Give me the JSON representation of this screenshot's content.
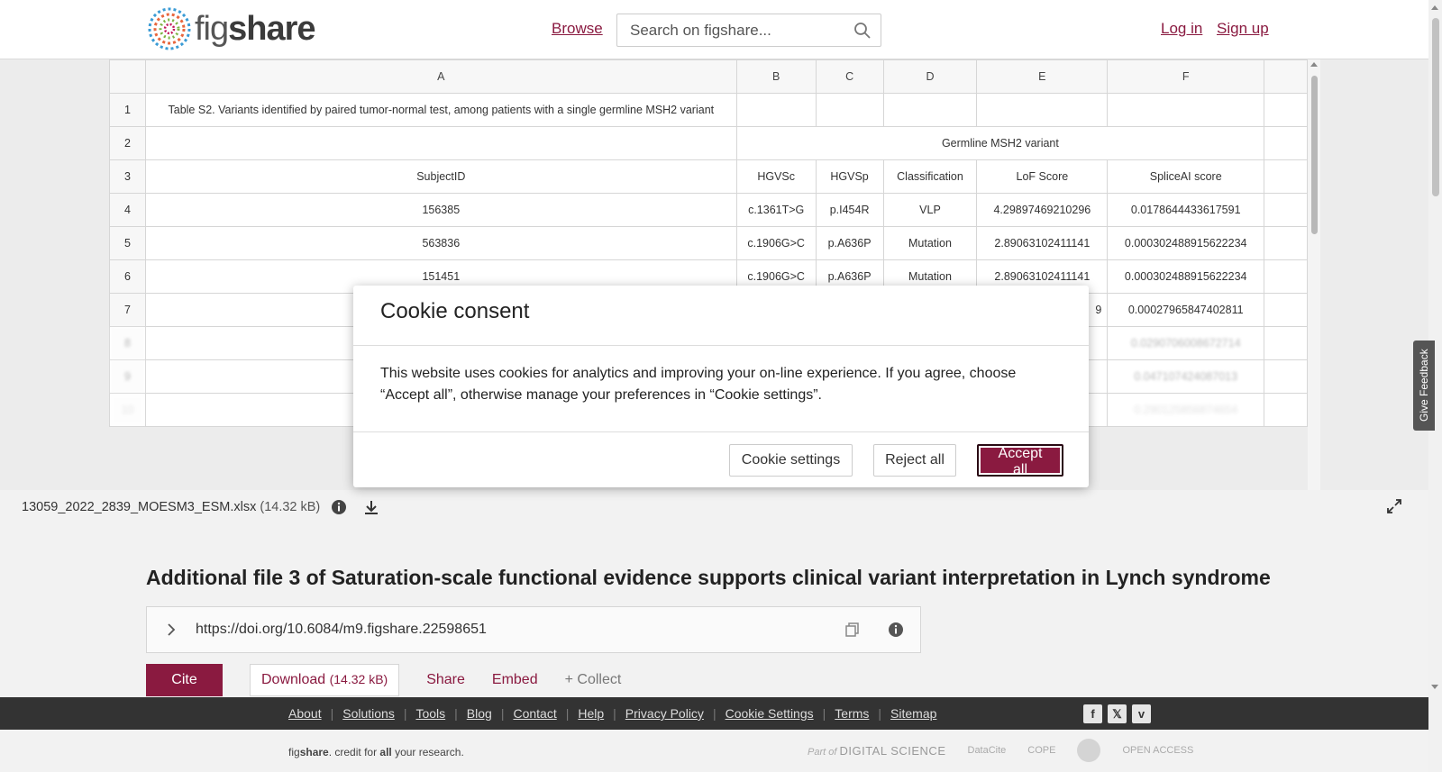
{
  "header": {
    "logo_fig": "fig",
    "logo_share": "share",
    "browse": "Browse",
    "search_placeholder": "Search on figshare...",
    "login": "Log in",
    "signup": "Sign up"
  },
  "sheet": {
    "columns": [
      "A",
      "B",
      "C",
      "D",
      "E",
      "F"
    ],
    "rows": [
      {
        "num": "1",
        "cells": [
          "Table S2. Variants identified by paired tumor-normal test, among patients with a single germline MSH2 variant",
          "",
          "",
          "",
          "",
          ""
        ]
      },
      {
        "num": "2",
        "cells": [
          "",
          "Germline MSH2 variant"
        ]
      },
      {
        "num": "3",
        "cells": [
          "SubjectID",
          "HGVSc",
          "HGVSp",
          "Classification",
          "LoF Score",
          "SpliceAI score"
        ]
      },
      {
        "num": "4",
        "cells": [
          "156385",
          "c.1361T>G",
          "p.I454R",
          "VLP",
          "4.29897469210296",
          "0.0178644433617591"
        ]
      },
      {
        "num": "5",
        "cells": [
          "563836",
          "c.1906G>C",
          "p.A636P",
          "Mutation",
          "2.89063102411141",
          "0.000302488915622234"
        ]
      },
      {
        "num": "6",
        "cells": [
          "151451",
          "c.1906G>C",
          "p.A636P",
          "Mutation",
          "2.89063102411141",
          "0.000302488915622234"
        ]
      },
      {
        "num": "7",
        "cells": [
          "",
          "",
          "",
          "",
          "9",
          "0.00027965847402811"
        ]
      },
      {
        "num": "8",
        "cells": [
          "",
          "",
          "",
          "",
          "",
          "0.0290706008672714"
        ]
      },
      {
        "num": "9",
        "cells": [
          "",
          "",
          "",
          "",
          "",
          "0.047107424087013"
        ]
      },
      {
        "num": "10",
        "cells": [
          "",
          "",
          "",
          "",
          "",
          "0.290125856874654"
        ]
      }
    ]
  },
  "file": {
    "name": "13059_2022_2839_MOESM3_ESM.xlsx",
    "size": "(14.32 kB)"
  },
  "article": {
    "title": "Additional file 3 of Saturation-scale functional evidence supports clinical variant interpretation in Lynch syndrome",
    "doi": "https://doi.org/10.6084/m9.figshare.22598651",
    "cite": "Cite",
    "download": "Download",
    "download_size": "(14.32 kB)",
    "share": "Share",
    "embed": "Embed",
    "collect": "+ Collect"
  },
  "footer": {
    "links": [
      "About",
      "Solutions",
      "Tools",
      "Blog",
      "Contact",
      "Help",
      "Privacy Policy",
      "Cookie Settings",
      "Terms",
      "Sitemap"
    ],
    "tagline_fig": "fig",
    "tagline_share": "share",
    "tagline_mid": ". credit for ",
    "tagline_all": "all",
    "tagline_end": " your research.",
    "partner_part_of": "Part of",
    "partner_ds": "DIGITAL SCIENCE",
    "partner_datacite": "DataCite",
    "partner_cope": "COPE",
    "partner_oa": "OPEN ACCESS"
  },
  "feedback": "Give Feedback",
  "cookie": {
    "title": "Cookie consent",
    "body": "This website uses cookies for analytics and improving your on-line experience. If you agree, choose “Accept all”, otherwise manage your preferences in “Cookie settings”.",
    "settings": "Cookie settings",
    "reject": "Reject all",
    "accept": "Accept all"
  },
  "colors": {
    "brand": "#8a1a40",
    "footer_bg": "#333333"
  }
}
